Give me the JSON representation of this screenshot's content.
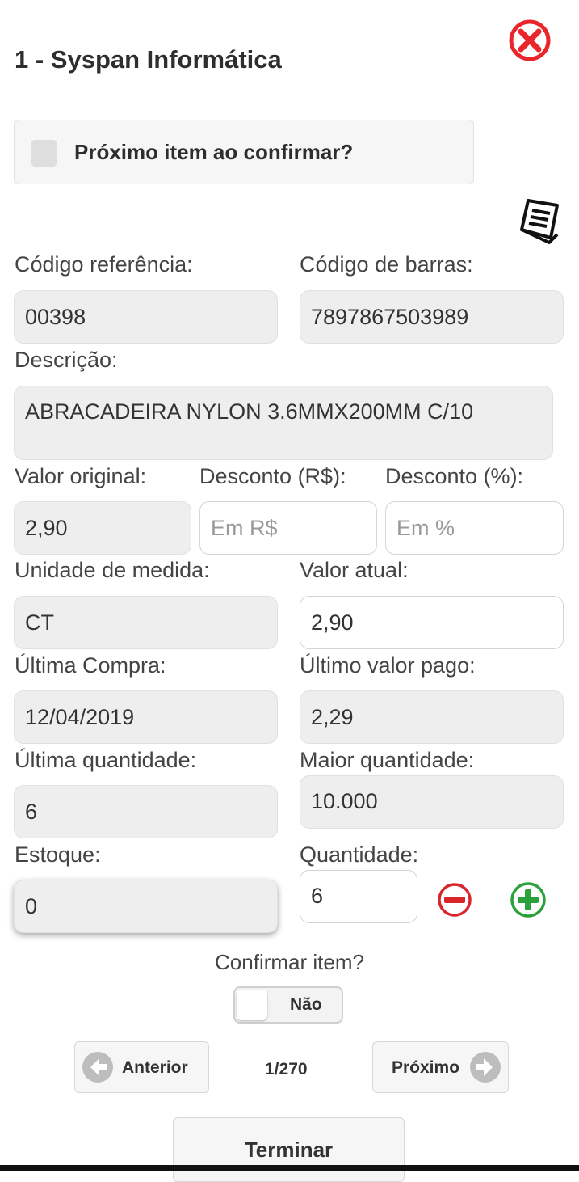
{
  "header": {
    "title": "1 - Syspan Informática",
    "close_icon": "close-icon",
    "close_color": "#e8262b"
  },
  "next_item": {
    "label": "Próximo item ao confirmar?",
    "checked": false
  },
  "receipt_icon": "receipt-icon",
  "form": {
    "ref_label": "Código referência:",
    "ref_value": "00398",
    "barcode_label": "Código de barras:",
    "barcode_value": "7897867503989",
    "desc_label": "Descrição:",
    "desc_value": "ABRACADEIRA NYLON 3.6MMX200MM C/10",
    "orig_label": "Valor original:",
    "orig_value": "2,90",
    "disc_rs_label": "Desconto (R$):",
    "disc_rs_placeholder": "Em R$",
    "disc_pct_label": "Desconto (%):",
    "disc_pct_placeholder": "Em %",
    "unit_label": "Unidade de medida:",
    "unit_value": "CT",
    "current_label": "Valor atual:",
    "current_value": "2,90",
    "last_purchase_label": "Última Compra:",
    "last_purchase_value": "12/04/2019",
    "last_paid_label": "Último valor pago:",
    "last_paid_value": "2,29",
    "last_qty_label": "Última quantidade:",
    "last_qty_value": "6",
    "max_qty_label": "Maior quantidade:",
    "max_qty_value": "10.000",
    "stock_label": "Estoque:",
    "stock_value": "0",
    "qty_label": "Quantidade:",
    "qty_value": "6",
    "minus_icon": "minus-circle-icon",
    "plus_icon": "plus-circle-icon",
    "minus_color": "#d9262b",
    "plus_color": "#2aa13a"
  },
  "confirm": {
    "label": "Confirmar item?",
    "toggle_text": "Não"
  },
  "navigation": {
    "prev_label": "Anterior",
    "prev_icon": "arrow-left-icon",
    "page": "1/270",
    "next_label": "Próximo",
    "next_icon": "arrow-right-icon",
    "finish_label": "Terminar"
  }
}
